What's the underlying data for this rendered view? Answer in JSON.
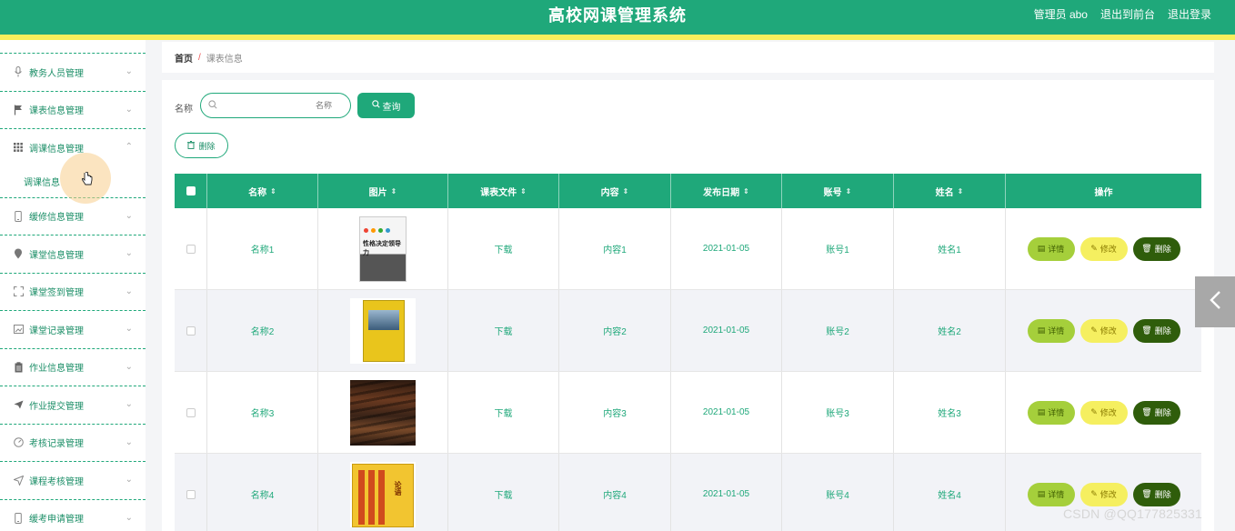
{
  "header": {
    "title": "高校网课管理系统",
    "user_label": "管理员 abo",
    "front_link": "退出到前台",
    "logout_link": "退出登录"
  },
  "sidebar": {
    "items": [
      {
        "label": "教务人员管理",
        "icon": "microphone-icon"
      },
      {
        "label": "课表信息管理",
        "icon": "flag-icon"
      },
      {
        "label": "调课信息管理",
        "icon": "grid-icon",
        "expanded": true,
        "children": [
          "调课信息"
        ]
      },
      {
        "label": "缓修信息管理",
        "icon": "phone-icon"
      },
      {
        "label": "课堂信息管理",
        "icon": "location-icon"
      },
      {
        "label": "课堂签到管理",
        "icon": "fullscreen-icon"
      },
      {
        "label": "课堂记录管理",
        "icon": "picture-icon"
      },
      {
        "label": "作业信息管理",
        "icon": "clipboard-icon"
      },
      {
        "label": "作业提交管理",
        "icon": "send-icon"
      },
      {
        "label": "考核记录管理",
        "icon": "gauge-icon"
      },
      {
        "label": "课程考核管理",
        "icon": "navigation-icon"
      },
      {
        "label": "缓考申请管理",
        "icon": "phone-icon"
      }
    ]
  },
  "breadcrumb": {
    "home": "首页",
    "separator": "/",
    "current": "课表信息"
  },
  "search": {
    "label": "名称",
    "placeholder": "名称",
    "query_button": "查询"
  },
  "toolbar": {
    "delete_label": "删除"
  },
  "table": {
    "headers": [
      "名称",
      "图片",
      "课表文件",
      "内容",
      "发布日期",
      "账号",
      "姓名",
      "操作"
    ],
    "rows": [
      {
        "name": "名称1",
        "file": "下载",
        "content": "内容1",
        "date": "2021-01-05",
        "account": "账号1",
        "person": "姓名1"
      },
      {
        "name": "名称2",
        "file": "下载",
        "content": "内容2",
        "date": "2021-01-05",
        "account": "账号2",
        "person": "姓名2"
      },
      {
        "name": "名称3",
        "file": "下载",
        "content": "内容3",
        "date": "2021-01-05",
        "account": "账号3",
        "person": "姓名3"
      },
      {
        "name": "名称4",
        "file": "下载",
        "content": "内容4",
        "date": "2021-01-05",
        "account": "账号4",
        "person": "姓名4"
      }
    ],
    "actions": {
      "detail": "详情",
      "edit": "修改",
      "delete": "删除"
    }
  },
  "images": {
    "book1_title": "性格决定领导力",
    "book4_title": "论语"
  },
  "colors": {
    "primary": "#1fa87a",
    "accent_stripe": "#f7ef5c",
    "detail_button": "#a5cf3b",
    "edit_button": "#f5ef60",
    "delete_button": "#2f5d0b"
  },
  "watermark": "CSDN @QQ177825331"
}
